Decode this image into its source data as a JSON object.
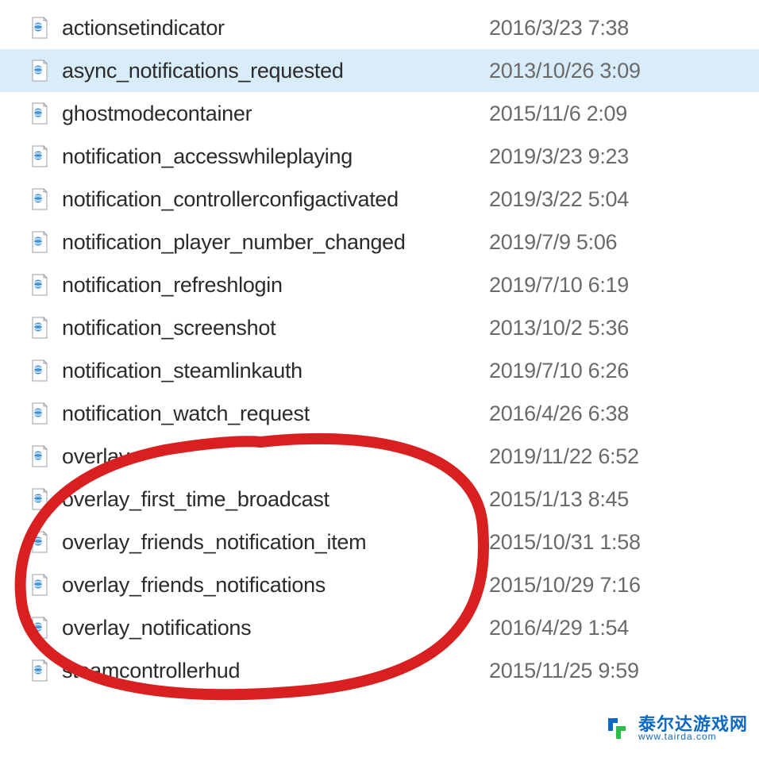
{
  "files": [
    {
      "name": "actionsetindicator",
      "date": "2016/3/23 7:38",
      "selected": false
    },
    {
      "name": "async_notifications_requested",
      "date": "2013/10/26 3:09",
      "selected": true
    },
    {
      "name": "ghostmodecontainer",
      "date": "2015/11/6 2:09",
      "selected": false
    },
    {
      "name": "notification_accesswhileplaying",
      "date": "2019/3/23 9:23",
      "selected": false
    },
    {
      "name": "notification_controllerconfigactivated",
      "date": "2019/3/22 5:04",
      "selected": false
    },
    {
      "name": "notification_player_number_changed",
      "date": "2019/7/9 5:06",
      "selected": false
    },
    {
      "name": "notification_refreshlogin",
      "date": "2019/7/10 6:19",
      "selected": false
    },
    {
      "name": "notification_screenshot",
      "date": "2013/10/2 5:36",
      "selected": false
    },
    {
      "name": "notification_steamlinkauth",
      "date": "2019/7/10 6:26",
      "selected": false
    },
    {
      "name": "notification_watch_request",
      "date": "2016/4/26 6:38",
      "selected": false
    },
    {
      "name": "overlay",
      "date": "2019/11/22 6:52",
      "selected": false
    },
    {
      "name": "overlay_first_time_broadcast",
      "date": "2015/1/13 8:45",
      "selected": false
    },
    {
      "name": "overlay_friends_notification_item",
      "date": "2015/10/31 1:58",
      "selected": false
    },
    {
      "name": "overlay_friends_notifications",
      "date": "2015/10/29 7:16",
      "selected": false
    },
    {
      "name": "overlay_notifications",
      "date": "2016/4/29 1:54",
      "selected": false
    },
    {
      "name": "steamcontrollerhud",
      "date": "2015/11/25 9:59",
      "selected": false
    }
  ],
  "watermark": {
    "text": "泰尔达游戏网",
    "sub": "www.tairda.com"
  }
}
